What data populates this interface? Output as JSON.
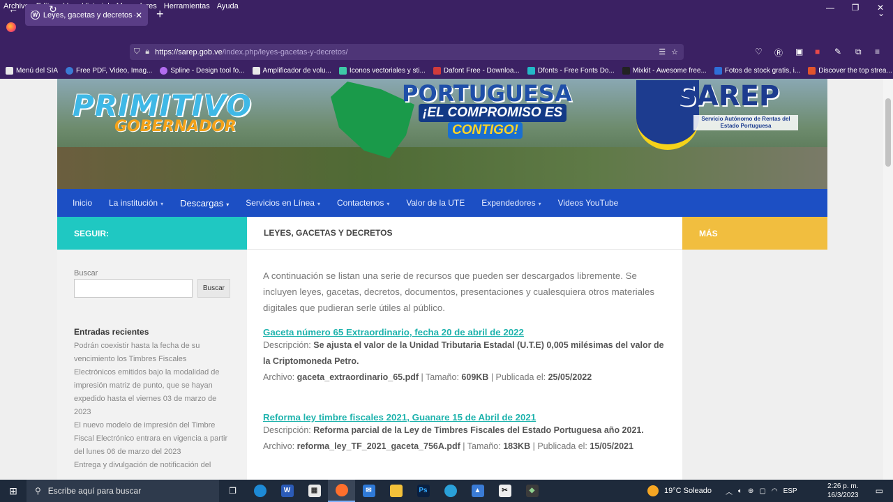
{
  "menubar": [
    "Archivo",
    "Editar",
    "Ver",
    "Historial",
    "Marcadores",
    "Herramientas",
    "Ayuda"
  ],
  "tab": {
    "title": "Leyes, gacetas y decretos – Serv"
  },
  "url": {
    "host": "https://sarep.gob.ve",
    "path": "/index.php/leyes-gacetas-y-decretos/"
  },
  "bookmarks": [
    {
      "label": "Menú del SIA",
      "color": "#e8e8e8"
    },
    {
      "label": "Free PDF, Video, Imag...",
      "color": "#3a7bd5"
    },
    {
      "label": "Spline - Design tool fo...",
      "color": "#b36cf0"
    },
    {
      "label": "Amplificador de volu...",
      "color": "#e8e8e8"
    },
    {
      "label": "Iconos vectoriales y sti...",
      "color": "#3ec9a7"
    },
    {
      "label": "Dafont Free - Downloa...",
      "color": "#d23b3b"
    },
    {
      "label": "Dfonts - Free Fonts Do...",
      "color": "#23b9c7"
    },
    {
      "label": "Mixkit - Awesome free...",
      "color": "#222222"
    },
    {
      "label": "Fotos de stock gratis, i...",
      "color": "#2e6fd8"
    },
    {
      "label": "Discover the top strea...",
      "color": "#e2542c"
    }
  ],
  "banner": {
    "logo1": "PRIMITIVO",
    "logo1b": "GOBERNADOR",
    "port1": "PORTUGUESA",
    "port2": "¡EL COMPROMISO ES",
    "port3": "CONTIGO!",
    "sarep": "SAREP",
    "sarep_sub": "Servicio Autónomo de Rentas del Estado Portuguesa"
  },
  "nav": [
    {
      "label": "Inicio",
      "caret": ""
    },
    {
      "label": "La institución",
      "caret": "▾"
    },
    {
      "label": "Descargas",
      "caret": "▾"
    },
    {
      "label": "Servicios en Línea",
      "caret": "▾"
    },
    {
      "label": "Contactenos",
      "caret": "▾"
    },
    {
      "label": "Valor de la UTE",
      "caret": ""
    },
    {
      "label": "Expendedores",
      "caret": "▾"
    },
    {
      "label": "Videos YouTube",
      "caret": ""
    }
  ],
  "headers": {
    "seguir": "SEGUIR:",
    "main": "LEYES, GACETAS Y DECRETOS",
    "mas": "MÁS"
  },
  "sidebar": {
    "search_label": "Buscar",
    "search_button": "Buscar",
    "recent_heading": "Entradas recientes",
    "recent_text": "Podrán coexistir hasta la fecha de su vencimiento los Timbres Fiscales Electrónicos emitidos bajo la modalidad de impresión matriz de punto, que se hayan expedido hasta el viernes 03 de marzo de 2023",
    "recent_text2": "El nuevo modelo de impresión del Timbre Fiscal Electrónico entrara en vigencia a partir del lunes 06 de marzo del 2023",
    "recent_text3": "Entrega y divulgación de notificación del"
  },
  "content": {
    "intro": "A continuación se listan una serie de recursos que pueden ser descargados libremente. Se incluyen leyes, gacetas, decretos, documentos, presentaciones y cualesquiera otros materiales digitales que pudieran serle útiles al público.",
    "entries": [
      {
        "title": "Gaceta número 65 Extraordinario, fecha 20 de abril de 2022",
        "desc_label": "Descripción:",
        "desc": "Se ajusta el valor de la Unidad Tributaria Estadal (U.T.E) 0,005 milésimas del valor de la Criptomoneda Petro.",
        "file_label": "Archivo:",
        "file": "gaceta_extraordinario_65.pdf",
        "size_label": "| Tamaño:",
        "size": "609KB",
        "pub_label": "| Publicada el:",
        "date": "25/05/2022"
      },
      {
        "title": "Reforma ley timbre fiscales 2021, Guanare 15 de Abril de 2021",
        "desc_label": "Descripción:",
        "desc": "Reforma parcial de la Ley de Timbres Fiscales del Estado Portuguesa año 2021.",
        "file_label": "Archivo:",
        "file": "reforma_ley_TF_2021_gaceta_756A.pdf",
        "size_label": "| Tamaño:",
        "size": "183KB",
        "pub_label": "| Publicada el:",
        "date": "15/05/2021"
      }
    ]
  },
  "taskbar": {
    "search_placeholder": "Escribe aquí para buscar",
    "weather": "19°C  Soleado",
    "lang": "ESP",
    "time": "2:26 p. m.",
    "date": "16/3/2023"
  }
}
